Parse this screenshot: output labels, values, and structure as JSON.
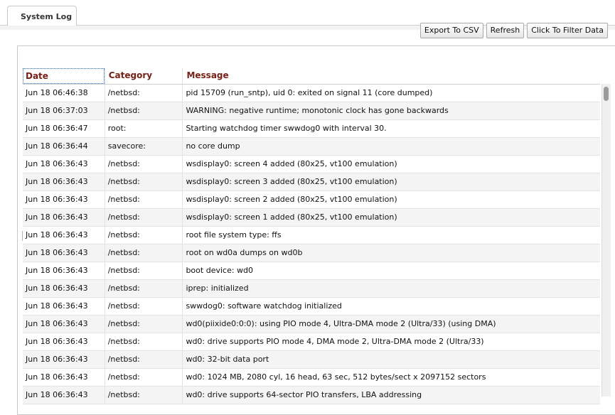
{
  "tab": {
    "label": "System Log"
  },
  "toolbar": {
    "export_label": "Export To CSV",
    "refresh_label": "Refresh",
    "filter_label": "Click To Filter Data"
  },
  "columns": {
    "date": "Date",
    "category": "Category",
    "message": "Message"
  },
  "rows": [
    {
      "date": "Jun 18 06:46:38",
      "category": "/netbsd:",
      "message": "pid 15709 (run_sntp), uid 0: exited on signal 11 (core dumped)"
    },
    {
      "date": "Jun 18 06:37:03",
      "category": "/netbsd:",
      "message": "WARNING: negative runtime; monotonic clock has gone backwards"
    },
    {
      "date": "Jun 18 06:36:47",
      "category": "root:",
      "message": "Starting watchdog timer swwdog0 with interval 30."
    },
    {
      "date": "Jun 18 06:36:44",
      "category": "savecore:",
      "message": "no core dump"
    },
    {
      "date": "Jun 18 06:36:43",
      "category": "/netbsd:",
      "message": "wsdisplay0: screen 4 added (80x25, vt100 emulation)"
    },
    {
      "date": "Jun 18 06:36:43",
      "category": "/netbsd:",
      "message": "wsdisplay0: screen 3 added (80x25, vt100 emulation)"
    },
    {
      "date": "Jun 18 06:36:43",
      "category": "/netbsd:",
      "message": "wsdisplay0: screen 2 added (80x25, vt100 emulation)"
    },
    {
      "date": "Jun 18 06:36:43",
      "category": "/netbsd:",
      "message": "wsdisplay0: screen 1 added (80x25, vt100 emulation)"
    },
    {
      "date": "Jun 18 06:36:43",
      "category": "/netbsd:",
      "message": "root file system type: ffs"
    },
    {
      "date": "Jun 18 06:36:43",
      "category": "/netbsd:",
      "message": "root on wd0a dumps on wd0b"
    },
    {
      "date": "Jun 18 06:36:43",
      "category": "/netbsd:",
      "message": "boot device: wd0"
    },
    {
      "date": "Jun 18 06:36:43",
      "category": "/netbsd:",
      "message": "iprep: initialized"
    },
    {
      "date": "Jun 18 06:36:43",
      "category": "/netbsd:",
      "message": "swwdog0: software watchdog initialized"
    },
    {
      "date": "Jun 18 06:36:43",
      "category": "/netbsd:",
      "message": "wd0(piixide0:0:0): using PIO mode 4, Ultra-DMA mode 2 (Ultra/33) (using DMA)"
    },
    {
      "date": "Jun 18 06:36:43",
      "category": "/netbsd:",
      "message": "wd0: drive supports PIO mode 4, DMA mode 2, Ultra-DMA mode 2 (Ultra/33)"
    },
    {
      "date": "Jun 18 06:36:43",
      "category": "/netbsd:",
      "message": "wd0: 32-bit data port"
    },
    {
      "date": "Jun 18 06:36:43",
      "category": "/netbsd:",
      "message": "wd0: 1024 MB, 2080 cyl, 16 head, 63 sec, 512 bytes/sect x 2097152 sectors"
    },
    {
      "date": "Jun 18 06:36:43",
      "category": "/netbsd:",
      "message": "wd0: drive supports 64-sector PIO transfers, LBA addressing"
    }
  ]
}
